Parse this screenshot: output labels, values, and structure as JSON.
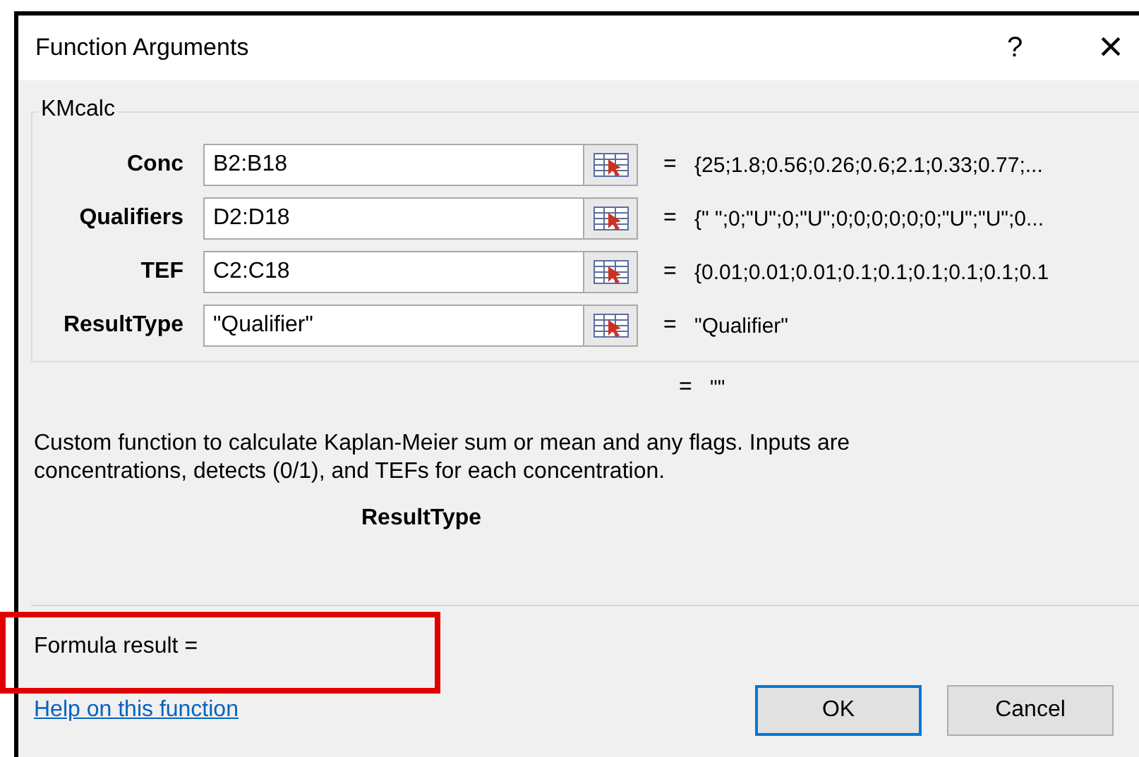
{
  "window": {
    "title": "Function Arguments",
    "help_glyph": "?",
    "close_glyph": "×"
  },
  "group": {
    "title": "KMcalc"
  },
  "arguments": [
    {
      "name": "Conc",
      "value": "B2:B18",
      "equals": "=",
      "result": "{25;1.8;0.56;0.26;0.6;2.1;0.33;0.77;..."
    },
    {
      "name": "Qualifiers",
      "value": "D2:D18",
      "equals": "=",
      "result": "{\" \";0;\"U\";0;\"U\";0;0;0;0;0;0;\"U\";\"U\";0..."
    },
    {
      "name": "TEF",
      "value": "C2:C18",
      "equals": "=",
      "result": "{0.01;0.01;0.01;0.1;0.1;0.1;0.1;0.1;0.1"
    },
    {
      "name": "ResultType",
      "value": "\"Qualifier\"",
      "equals": "=",
      "result": "\"Qualifier\""
    }
  ],
  "overall_result": {
    "equals": "=",
    "value": "\"\""
  },
  "description": "Custom function to calculate Kaplan-Meier sum or mean and any flags.  Inputs are concentrations, detects (0/1), and TEFs for each concentration.",
  "argument_help": "ResultType",
  "formula_result": "Formula result =",
  "help_link": "Help on this function",
  "buttons": [
    {
      "label": "OK",
      "selected": true
    },
    {
      "label": "Cancel",
      "selected": false
    }
  ]
}
